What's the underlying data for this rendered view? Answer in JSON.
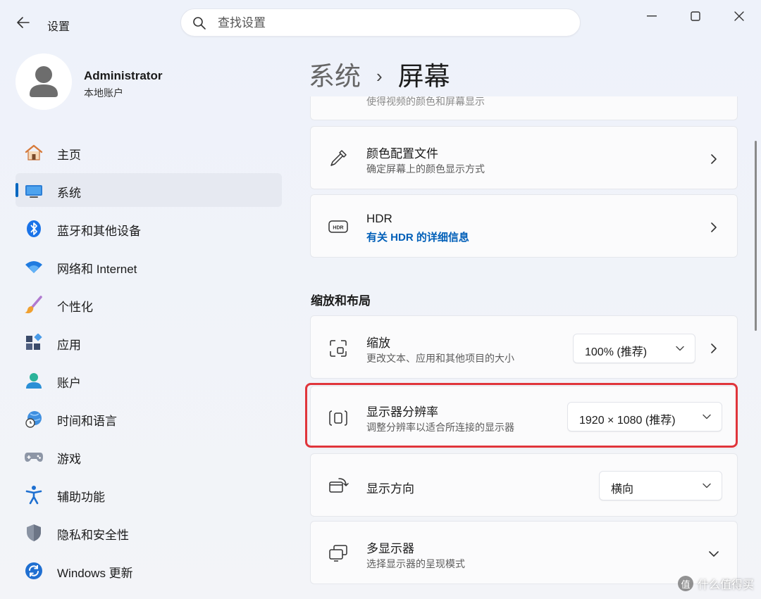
{
  "window": {
    "app_title": "设置",
    "search_placeholder": "查找设置"
  },
  "profile": {
    "name": "Administrator",
    "account_type": "本地账户"
  },
  "nav": {
    "items": [
      {
        "label": "主页",
        "icon": "home-icon"
      },
      {
        "label": "系统",
        "icon": "display-icon",
        "active": true
      },
      {
        "label": "蓝牙和其他设备",
        "icon": "bluetooth-icon"
      },
      {
        "label": "网络和 Internet",
        "icon": "wifi-icon"
      },
      {
        "label": "个性化",
        "icon": "brush-icon"
      },
      {
        "label": "应用",
        "icon": "apps-icon"
      },
      {
        "label": "账户",
        "icon": "person-icon"
      },
      {
        "label": "时间和语言",
        "icon": "clock-globe-icon"
      },
      {
        "label": "游戏",
        "icon": "gamepad-icon"
      },
      {
        "label": "辅助功能",
        "icon": "accessibility-icon"
      },
      {
        "label": "隐私和安全性",
        "icon": "shield-icon"
      },
      {
        "label": "Windows 更新",
        "icon": "update-icon"
      }
    ]
  },
  "breadcrumb": {
    "parent": "系统",
    "separator": "›",
    "current": "屏幕"
  },
  "cards": {
    "partial_sub": "使得视频的颜色和屏幕显示",
    "color_profile": {
      "title": "颜色配置文件",
      "subtitle": "确定屏幕上的颜色显示方式"
    },
    "hdr": {
      "title": "HDR",
      "link": "有关 HDR 的详细信息"
    },
    "section_scale_layout": "缩放和布局",
    "scale": {
      "title": "缩放",
      "subtitle": "更改文本、应用和其他项目的大小",
      "value": "100% (推荐)"
    },
    "resolution": {
      "title": "显示器分辨率",
      "subtitle": "调整分辨率以适合所连接的显示器",
      "value": "1920 × 1080 (推荐)"
    },
    "orientation": {
      "title": "显示方向",
      "value": "横向"
    },
    "multi_display": {
      "title": "多显示器",
      "subtitle": "选择显示器的呈现模式"
    }
  },
  "watermark": {
    "text": "什么值得买",
    "badge": "值"
  },
  "colors": {
    "accent": "#0067c0",
    "highlight": "#e0353b",
    "link": "#005fb8"
  }
}
